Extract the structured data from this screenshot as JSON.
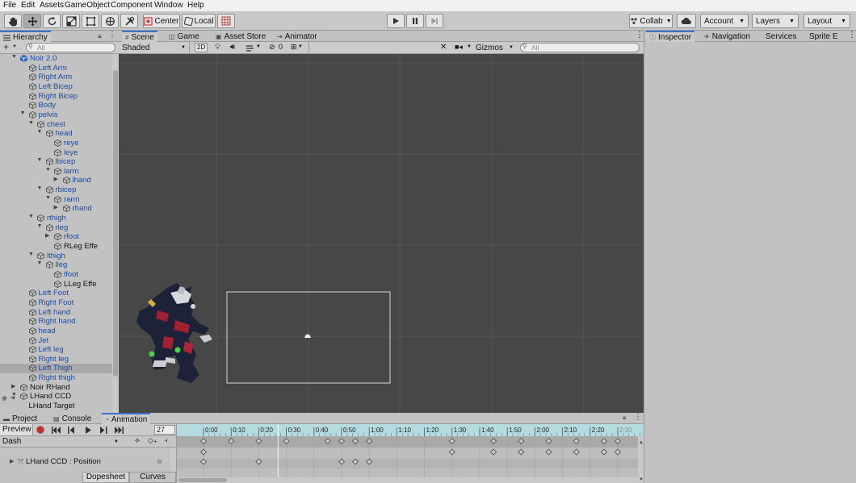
{
  "menu": [
    "File",
    "Edit",
    "Assets",
    "GameObject",
    "Component",
    "Window",
    "Help"
  ],
  "toolbar": {
    "tools": [
      "hand-tool",
      "move-tool",
      "rotate-tool",
      "scale-tool",
      "rect-tool",
      "transform-tool",
      "custom-tool"
    ],
    "pivot_label": "Center",
    "space_label": "Local",
    "collab_label": "Collab",
    "account_label": "Account",
    "layers_label": "Layers",
    "layout_label": "Layout"
  },
  "hierarchy": {
    "title": "Hierarchy",
    "add_label": "+",
    "search_placeholder": "All",
    "rows": [
      {
        "label": "Noir 2.0",
        "depth": 1,
        "arrow": "down",
        "icon": "prefab-blue-cube-icon",
        "black": false,
        "selected": false
      },
      {
        "label": "Left Arm",
        "depth": 2,
        "arrow": "",
        "icon": "cube-icon",
        "black": false,
        "selected": false
      },
      {
        "label": "Right Arm",
        "depth": 2,
        "arrow": "",
        "icon": "cube-icon",
        "black": false,
        "selected": false
      },
      {
        "label": "Left Bicep",
        "depth": 2,
        "arrow": "",
        "icon": "cube-icon",
        "black": false,
        "selected": false
      },
      {
        "label": "Right Bicep",
        "depth": 2,
        "arrow": "",
        "icon": "cube-icon",
        "black": false,
        "selected": false
      },
      {
        "label": "Body",
        "depth": 2,
        "arrow": "",
        "icon": "cube-icon",
        "black": false,
        "selected": false
      },
      {
        "label": "pelvis",
        "depth": 2,
        "arrow": "down",
        "icon": "cube-icon",
        "black": false,
        "selected": false
      },
      {
        "label": "chest",
        "depth": 3,
        "arrow": "down",
        "icon": "cube-icon",
        "black": false,
        "selected": false
      },
      {
        "label": "head",
        "depth": 4,
        "arrow": "down",
        "icon": "cube-icon",
        "black": false,
        "selected": false
      },
      {
        "label": "reye",
        "depth": 5,
        "arrow": "",
        "icon": "cube-icon",
        "black": false,
        "selected": false
      },
      {
        "label": "leye",
        "depth": 5,
        "arrow": "",
        "icon": "cube-icon",
        "black": false,
        "selected": false
      },
      {
        "label": "lbicep",
        "depth": 4,
        "arrow": "down",
        "icon": "cube-icon",
        "black": false,
        "selected": false
      },
      {
        "label": "larm",
        "depth": 5,
        "arrow": "down",
        "icon": "cube-icon",
        "black": false,
        "selected": false
      },
      {
        "label": "lhand",
        "depth": 6,
        "arrow": "right",
        "icon": "cube-icon",
        "black": false,
        "selected": false
      },
      {
        "label": "rbicep",
        "depth": 4,
        "arrow": "down",
        "icon": "cube-icon",
        "black": false,
        "selected": false
      },
      {
        "label": "rarm",
        "depth": 5,
        "arrow": "down",
        "icon": "cube-icon",
        "black": false,
        "selected": false
      },
      {
        "label": "rhand",
        "depth": 6,
        "arrow": "right",
        "icon": "cube-icon",
        "black": false,
        "selected": false
      },
      {
        "label": "rthigh",
        "depth": 3,
        "arrow": "down",
        "icon": "cube-icon",
        "black": false,
        "selected": false
      },
      {
        "label": "rleg",
        "depth": 4,
        "arrow": "down",
        "icon": "cube-icon",
        "black": false,
        "selected": false
      },
      {
        "label": "rfoot",
        "depth": 5,
        "arrow": "right",
        "icon": "cube-icon",
        "black": false,
        "selected": false
      },
      {
        "label": "RLeg Effe",
        "depth": 5,
        "arrow": "",
        "icon": "cube-icon",
        "black": true,
        "selected": false
      },
      {
        "label": "lthigh",
        "depth": 3,
        "arrow": "down",
        "icon": "cube-icon",
        "black": false,
        "selected": false
      },
      {
        "label": "lleg",
        "depth": 4,
        "arrow": "down",
        "icon": "cube-icon",
        "black": false,
        "selected": false
      },
      {
        "label": "lfoot",
        "depth": 5,
        "arrow": "",
        "icon": "cube-icon",
        "black": false,
        "selected": false
      },
      {
        "label": "LLeg Effe",
        "depth": 5,
        "arrow": "",
        "icon": "cube-icon",
        "black": true,
        "selected": false
      },
      {
        "label": "Left Foot",
        "depth": 2,
        "arrow": "",
        "icon": "cube-icon",
        "black": false,
        "selected": false
      },
      {
        "label": "Right Foot",
        "depth": 2,
        "arrow": "",
        "icon": "cube-icon",
        "black": false,
        "selected": false
      },
      {
        "label": "Left hand",
        "depth": 2,
        "arrow": "",
        "icon": "cube-icon",
        "black": false,
        "selected": false
      },
      {
        "label": "Right hand",
        "depth": 2,
        "arrow": "",
        "icon": "cube-icon",
        "black": false,
        "selected": false
      },
      {
        "label": "head",
        "depth": 2,
        "arrow": "",
        "icon": "cube-icon",
        "black": false,
        "selected": false
      },
      {
        "label": "Jet",
        "depth": 2,
        "arrow": "",
        "icon": "cube-icon",
        "black": false,
        "selected": false
      },
      {
        "label": "Left leg",
        "depth": 2,
        "arrow": "",
        "icon": "cube-icon",
        "black": false,
        "selected": false
      },
      {
        "label": "Right leg",
        "depth": 2,
        "arrow": "",
        "icon": "cube-icon",
        "black": false,
        "selected": false
      },
      {
        "label": "Left Thigh",
        "depth": 2,
        "arrow": "",
        "icon": "cube-icon",
        "black": false,
        "selected": true
      },
      {
        "label": "Right thigh",
        "depth": 2,
        "arrow": "",
        "icon": "cube-icon",
        "black": false,
        "selected": false
      },
      {
        "label": "Noir RHand",
        "depth": 1,
        "arrow": "right",
        "icon": "cube-icon",
        "black": true,
        "selected": false
      },
      {
        "label": "LHand CCD",
        "depth": 1,
        "arrow": "down",
        "icon": "cube-icon",
        "black": true,
        "selected": false
      },
      {
        "label": "LHand Target",
        "depth": 2,
        "arrow": "",
        "icon": "",
        "black": true,
        "selected": false
      }
    ]
  },
  "scene_tabs": [
    {
      "label": "Scene",
      "icon": "hash-icon",
      "active": true
    },
    {
      "label": "Game",
      "icon": "gamepad-icon",
      "active": false
    },
    {
      "label": "Asset Store",
      "icon": "bag-icon",
      "active": false
    },
    {
      "label": "Animator",
      "icon": "animator-icon",
      "active": false
    }
  ],
  "scene_bar": {
    "shading_mode": "Shaded",
    "mode_2d": "2D",
    "hidden_count": "0",
    "gizmos_label": "Gizmos",
    "search_placeholder": "All"
  },
  "inspector_tabs": [
    {
      "label": "Inspector",
      "icon": "info-icon",
      "active": true
    },
    {
      "label": "Navigation",
      "icon": "navigation-icon",
      "active": false
    },
    {
      "label": "Services",
      "icon": "",
      "active": false
    },
    {
      "label": "Sprite E",
      "icon": "",
      "active": false
    }
  ],
  "bottom_tabs": [
    {
      "label": "Project",
      "icon": "folder-icon",
      "active": false
    },
    {
      "label": "Console",
      "icon": "console-icon",
      "active": false
    },
    {
      "label": "Animation",
      "icon": "animation-icon",
      "active": true
    }
  ],
  "animation": {
    "preview_label": "Preview",
    "frame_value": "27",
    "clip_name": "Dash",
    "property_label": "LHand CCD : Position",
    "dopesheet_label": "Dopesheet",
    "curves_label": "Curves",
    "time_labels": [
      "0:00",
      "0:10",
      "0:20",
      "0:30",
      "0:40",
      "0:50",
      "1:00",
      "1:10",
      "1:20",
      "1:30",
      "1:40",
      "1:50",
      "2:00",
      "2:10",
      "2:20",
      "2:30"
    ],
    "playhead_time": "0:27",
    "summary_keys": [
      "0:00",
      "0:10",
      "0:20",
      "0:30",
      "0:45",
      "0:50",
      "0:55",
      "1:00",
      "1:30",
      "1:45",
      "1:55",
      "2:05",
      "2:15",
      "2:25",
      "2:30"
    ],
    "row1_keys": [
      "0:00",
      "1:30",
      "1:45",
      "1:55",
      "2:05",
      "2:15",
      "2:25",
      "2:30"
    ],
    "row2_keys": [
      "0:00",
      "0:20",
      "0:50",
      "0:55",
      "1:00"
    ]
  },
  "colors": {
    "accent": "#3a72c9",
    "hierarchy_text": "#1b4aa5",
    "scene_bg": "#474747",
    "timeline_header": "#b3dbe0",
    "record_red": "#d02a2a"
  }
}
